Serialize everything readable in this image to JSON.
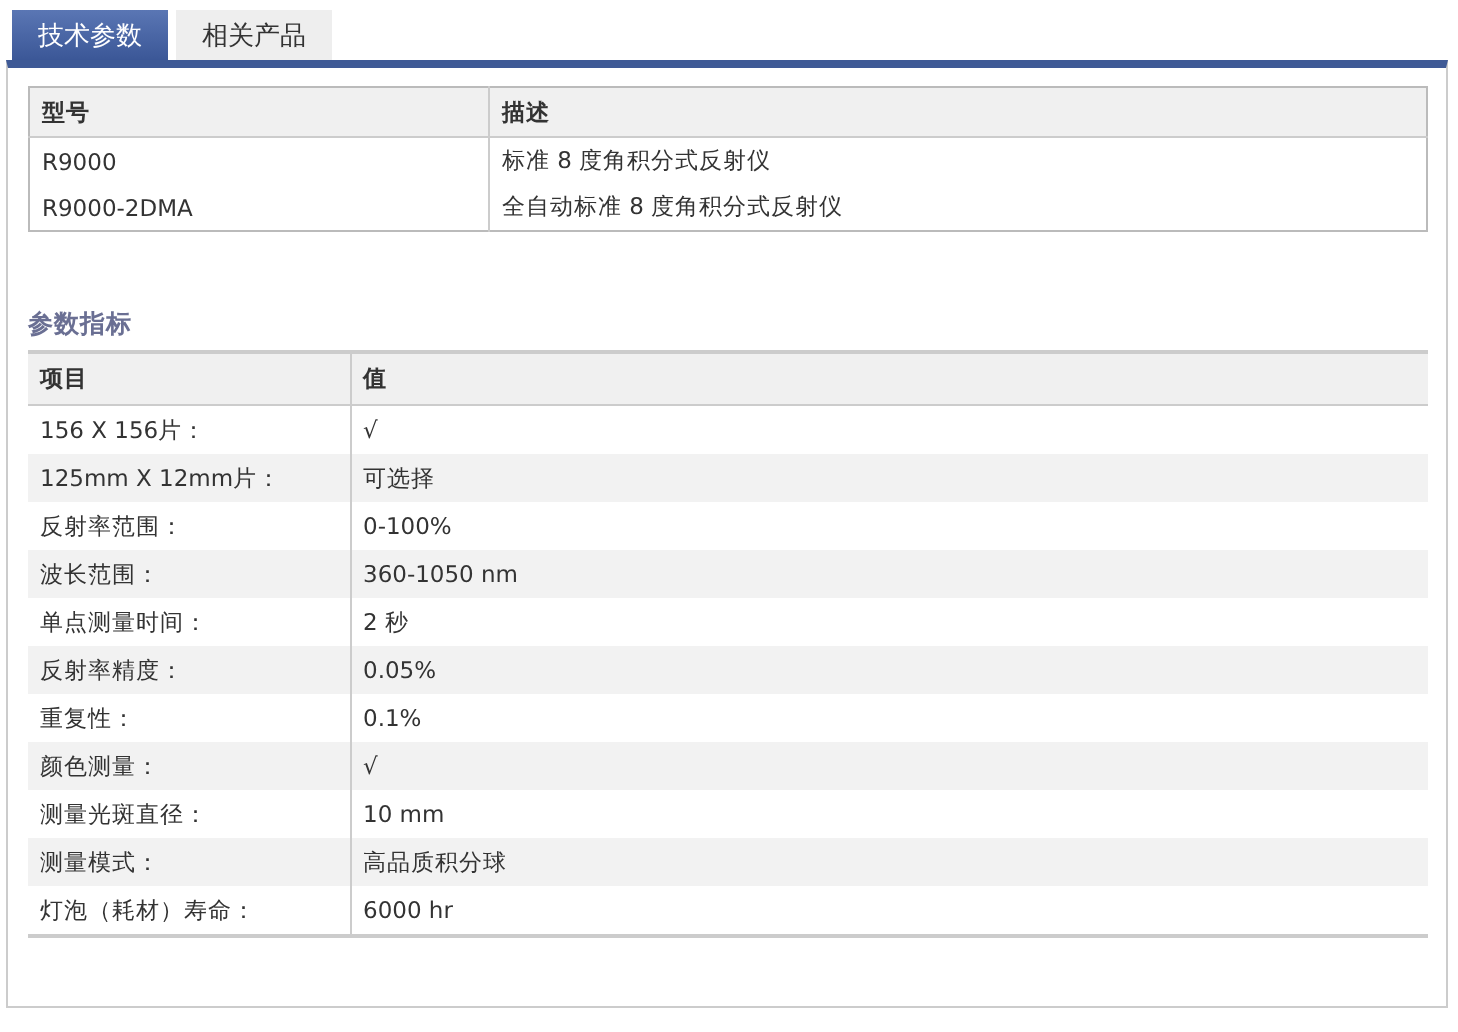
{
  "tabs": [
    {
      "label": "技术参数",
      "selected": true
    },
    {
      "label": "相关产品",
      "selected": false
    }
  ],
  "models_table": {
    "columns": [
      "型号",
      "描述"
    ],
    "rows": [
      [
        "R9000",
        "标准 8 度角积分式反射仪"
      ],
      [
        "R9000-2DMA",
        "全自动标准 8 度角积分式反射仪"
      ]
    ]
  },
  "specs": {
    "title": "参数指标",
    "columns": [
      "项目",
      "值"
    ],
    "rows": [
      [
        "156 X 156片：",
        "√"
      ],
      [
        "125mm X 12mm片：",
        "可选择"
      ],
      [
        "反射率范围：",
        "0-100%"
      ],
      [
        "波长范围：",
        "360-1050 nm"
      ],
      [
        "单点测量时间：",
        "2 秒"
      ],
      [
        "反射率精度：",
        "0.05%"
      ],
      [
        "重复性：",
        "0.1%"
      ],
      [
        "颜色测量：",
        "√"
      ],
      [
        "测量光斑直径：",
        "10 mm"
      ],
      [
        "测量模式：",
        "高品质积分球"
      ],
      [
        "灯泡（耗材）寿命：",
        "6000 hr"
      ]
    ]
  }
}
